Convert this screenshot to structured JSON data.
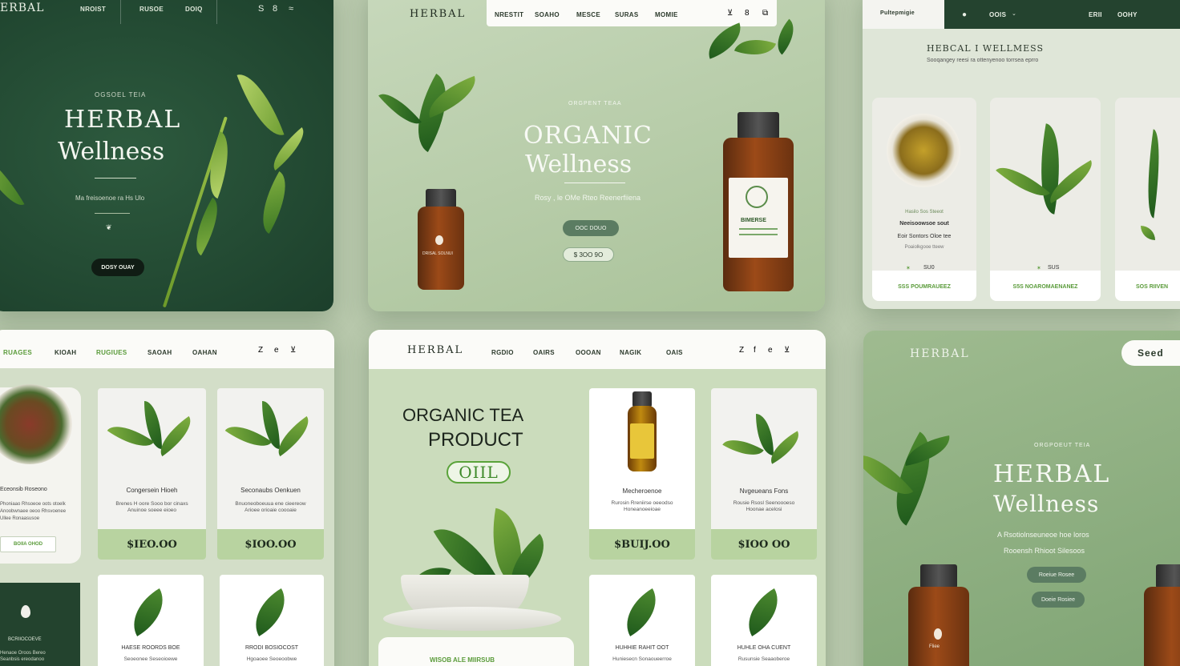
{
  "p1": {
    "brand": "ERBAL",
    "nav": [
      "NROIST",
      "RUSOE",
      "DOIQ"
    ],
    "icons": [
      "S",
      "8",
      "≈"
    ],
    "eyebrow": "OGSOEL TEIA",
    "title1": "HERBAL",
    "title2": "Wellness",
    "sub": "Ma freisoenoe ra Hs Ulo",
    "button": "DOSY OUAY"
  },
  "p2": {
    "brand": "HERBAL",
    "nav": [
      "NRESTIT",
      "SOAHO",
      "MESCE",
      "SURAS",
      "MOMIE"
    ],
    "icons": [
      "⊻",
      "8",
      "⧉"
    ],
    "eyebrow": "ORGPENT TEAA",
    "title1": "ORGANIC",
    "title2": "Wellness",
    "sub": "Rosy , le OMe Rteo Reenerfiiena",
    "button": "OOC DOUO",
    "price": "$ 3OO 9O",
    "bottle_small_label": "DRISAL SOLNUI",
    "bottle_big_label": "BIMERSE"
  },
  "p3": {
    "nav_active": "Pultepmigie",
    "nav": [
      "OOIS"
    ],
    "right": [
      "ERII",
      "OOHY"
    ],
    "title": "HEBCAL I WELLMESS",
    "subtitle": "Sooqangey reesi ra ottenyenoo torrsea eprro",
    "cards": [
      {
        "title": "Hasilo Sos Steeot",
        "sub": "Neeisoowsoe sout",
        "desc": "Eoir Sontors Oloe tee",
        "meta": "Poaiolkgooe tteew",
        "rating": "SU0",
        "footer": "SSS POUMRAUEEZ"
      },
      {
        "title": "",
        "sub": "",
        "desc": "",
        "meta": "",
        "rating": "SUS",
        "footer": "S5S NOAROMAENANEZ"
      },
      {
        "title": "",
        "sub": "",
        "desc": "",
        "meta": "",
        "rating": "",
        "footer": "SOS RIIVEN"
      }
    ]
  },
  "p4": {
    "nav": [
      "RUAGES",
      "KIOAH",
      "RUGIUES",
      "SAOAH",
      "OAHAN"
    ],
    "icons": [
      "Z",
      "e",
      "⊻"
    ],
    "side_title": "Eceonsib Roseono",
    "side_desc": "Phoniaao Rhsoeoe oots otoelk\nAnoobwnaee oeoo Rhsvoenee\nUllee Ronaasusoe",
    "side_button": "BOIIA OHOD",
    "bottom_title": "BCRIIOCOEVE",
    "bottom_desc": "Henaoe Oroos Bereo\nSeanbsis ereodanoo",
    "cards": [
      {
        "title": "Congersein Hioeh",
        "desc": "Brenes H oore Sooo bor cinaxs\nAnuinoe soeee eioeo",
        "price": "$IEO.OO"
      },
      {
        "title": "Seconaubs Oenkuen",
        "desc": "Bnuoneoboeuua ene cieereow\nArioee orioaie coooaie",
        "price": "$IOO.OO"
      }
    ],
    "lower": [
      {
        "title": "HAESE ROORDS BOE",
        "desc": "Seoeonee Seseoioewe"
      },
      {
        "title": "RRODI BOSIOCOST",
        "desc": "Hgoaoee Seoeoobwe"
      }
    ]
  },
  "p5": {
    "brand": "HERBAL",
    "nav": [
      "RGDIO",
      "OAIRS",
      "OOOAN",
      "NAGIK",
      "OAIS"
    ],
    "icons": [
      "Z",
      "f",
      "e",
      "⊻"
    ],
    "title1": "ORGANIC TEA",
    "title2": "PRODUCT",
    "badge": "OIIL",
    "cards": [
      {
        "title": "Mecheroenoe",
        "desc": "Rurosin Rreniirse oeeodso\nHoneanoeeioae",
        "price": "$BUIJ.OO"
      },
      {
        "title": "Nvgeueans Fons",
        "desc": "Rousie Rsosl Seenoooeso\nHoonae acelosi",
        "price": "$IOO OO"
      }
    ],
    "lower": [
      {
        "title": "HUHHIE RAHIT OOT",
        "desc": "Huniesecn Sonaoueerroe"
      },
      {
        "title": "HUHLE OHA CUENT",
        "desc": "Rusunsie Seaaoberoe"
      }
    ],
    "footer_text": "WISOB ALE MIIRSUB"
  },
  "p6": {
    "brand": "HERBAL",
    "search": "Seed",
    "eyebrow": "ORGPOEUT TEIA",
    "title1": "HERBAL",
    "title2": "Wellness",
    "line1": "A Rsotiolnseuneoe hoe loros",
    "line2": "Rooensh Rhioot Silesoos",
    "button1": "Roeiue Rosee",
    "button2": "Doeie Rosiee",
    "bottle_label": "Fliee"
  },
  "colors": {
    "dark_green": "#244a33",
    "sage": "#a9c299",
    "accent_green": "#5a9b3a",
    "price_band": "#b8d3a0"
  }
}
